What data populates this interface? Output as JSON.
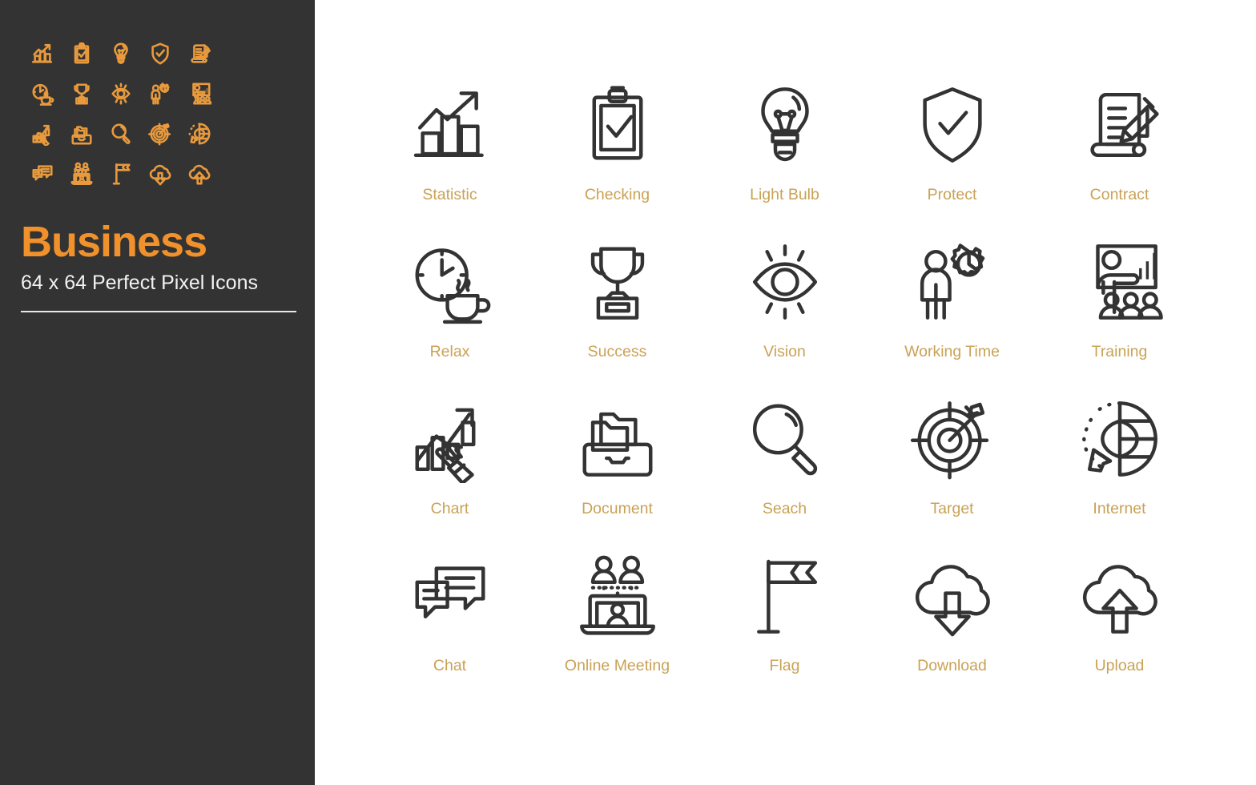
{
  "brand": {
    "title": "Business",
    "subtitle": "64 x 64 Perfect Pixel Icons",
    "accent_color": "#F0912C",
    "sidebar_background": "#333333",
    "label_color": "#C9A255",
    "icon_stroke_color": "#333333",
    "page_background": "#FFFFFF"
  },
  "grid": {
    "columns": 5,
    "rows": 4,
    "icons": [
      {
        "label": "Statistic",
        "icon": "bar-chart-arrow-up-icon"
      },
      {
        "label": "Checking",
        "icon": "clipboard-check-icon"
      },
      {
        "label": "Light Bulb",
        "icon": "light-bulb-icon"
      },
      {
        "label": "Protect",
        "icon": "shield-check-icon"
      },
      {
        "label": "Contract",
        "icon": "scroll-pencil-icon"
      },
      {
        "label": "Relax",
        "icon": "clock-coffee-cup-icon"
      },
      {
        "label": "Success",
        "icon": "trophy-icon"
      },
      {
        "label": "Vision",
        "icon": "eye-rays-icon"
      },
      {
        "label": "Working Time",
        "icon": "person-gear-clock-icon"
      },
      {
        "label": "Training",
        "icon": "presentation-audience-icon"
      },
      {
        "label": "Chart",
        "icon": "chart-hand-pointer-icon"
      },
      {
        "label": "Document",
        "icon": "file-drawer-folders-icon"
      },
      {
        "label": "Seach",
        "icon": "magnifying-glass-icon"
      },
      {
        "label": "Target",
        "icon": "target-arrow-icon"
      },
      {
        "label": "Internet",
        "icon": "globe-cursor-icon"
      },
      {
        "label": "Chat",
        "icon": "chat-bubbles-icon"
      },
      {
        "label": "Online Meeting",
        "icon": "laptop-video-call-icon"
      },
      {
        "label": "Flag",
        "icon": "flag-pole-icon"
      },
      {
        "label": "Download",
        "icon": "cloud-download-icon"
      },
      {
        "label": "Upload",
        "icon": "cloud-upload-icon"
      }
    ]
  },
  "sidebar_preview": {
    "columns": 5,
    "rows": 4,
    "icons": [
      "bar-chart-arrow-up-icon",
      "clipboard-check-icon",
      "light-bulb-icon",
      "shield-check-icon",
      "scroll-pencil-icon",
      "clock-coffee-cup-icon",
      "trophy-icon",
      "eye-rays-icon",
      "person-gear-clock-icon",
      "presentation-audience-icon",
      "chart-hand-pointer-icon",
      "file-drawer-folders-icon",
      "magnifying-glass-icon",
      "target-arrow-icon",
      "globe-cursor-icon",
      "chat-bubbles-icon",
      "laptop-video-call-icon",
      "flag-pole-icon",
      "cloud-download-icon",
      "cloud-upload-icon"
    ]
  }
}
